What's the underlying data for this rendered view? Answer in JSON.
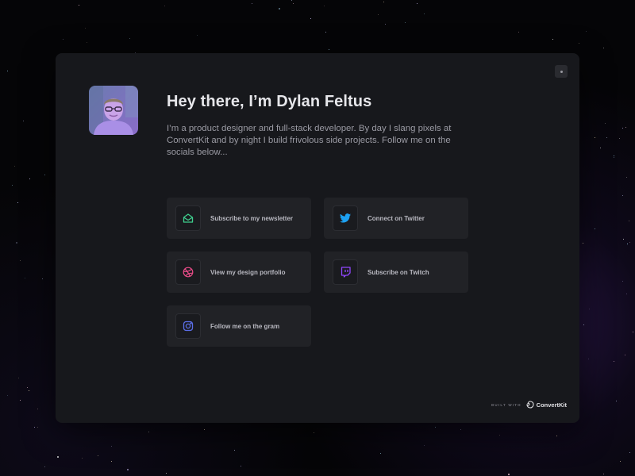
{
  "profile": {
    "avatar_alt": "avatar",
    "title": "Hey there, I’m Dylan Feltus",
    "bio": "I’m a product designer and full-stack developer. By day I slang pixels at ConvertKit and by night I build frivolous side projects. Follow me on the socials below..."
  },
  "links": [
    {
      "label": "Subscribe to my newsletter",
      "icon": "envelope-open-icon",
      "color": "#3fcf8e"
    },
    {
      "label": "Connect on Twitter",
      "icon": "twitter-icon",
      "color": "#1da1f2"
    },
    {
      "label": "View my design portfolio",
      "icon": "dribbble-icon",
      "color": "#ea4c89"
    },
    {
      "label": "Subscribe on Twitch",
      "icon": "twitch-icon",
      "color": "#9146ff"
    },
    {
      "label": "Follow me on the gram",
      "icon": "instagram-icon",
      "color": "#5b6ee8"
    }
  ],
  "footer": {
    "built_with": "BUILT WITH",
    "brand": "ConvertKit"
  },
  "theme": {
    "background": "#050507",
    "card": "#17181c",
    "button": "#212226"
  }
}
